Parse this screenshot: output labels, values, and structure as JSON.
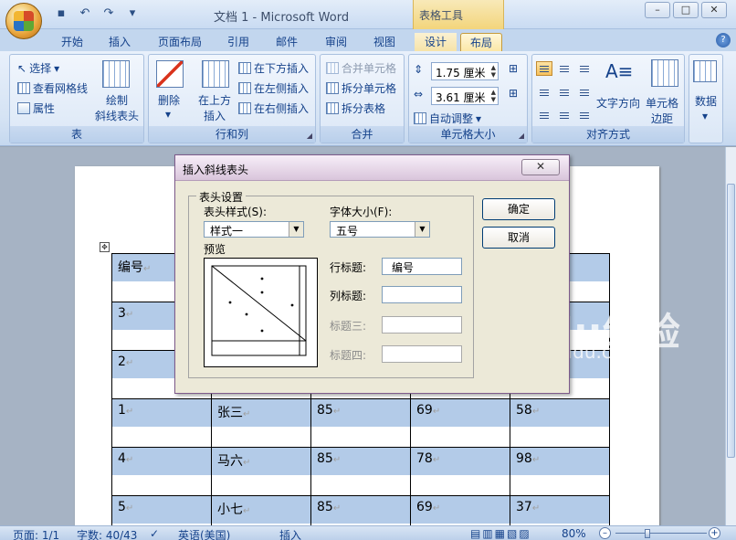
{
  "window": {
    "title": "文档 1 - Microsoft Word",
    "context_tools": "表格工具",
    "buttons": {
      "minimize": "–",
      "maximize": "□",
      "close": "✕"
    }
  },
  "qat": {
    "save_icon": "save-icon",
    "undo_icon": "undo-icon",
    "redo_icon": "redo-icon",
    "customize": "▾"
  },
  "tabs": [
    "开始",
    "插入",
    "页面布局",
    "引用",
    "邮件",
    "审阅",
    "视图",
    "设计",
    "布局"
  ],
  "active_tab": "布局",
  "ribbon": {
    "table_group": {
      "label": "表",
      "select": "选择",
      "view_gridlines": "查看网格线",
      "properties": "属性",
      "draw_diagonal": "绘制\n斜线表头",
      "draw_diagonal_line1": "绘制",
      "draw_diagonal_line2": "斜线表头"
    },
    "rows_cols_group": {
      "label": "行和列",
      "delete": "删除",
      "insert_above_1": "在上方",
      "insert_above_2": "插入",
      "insert_below": "在下方插入",
      "insert_left": "在左侧插入",
      "insert_right": "在右侧插入"
    },
    "merge_group": {
      "label": "合并",
      "merge_cells": "合并单元格",
      "split_cells": "拆分单元格",
      "split_table": "拆分表格"
    },
    "cell_size_group": {
      "label": "单元格大小",
      "height": "1.75 厘米",
      "width": "3.61 厘米",
      "autofit": "自动调整"
    },
    "alignment_group": {
      "label": "对齐方式",
      "text_direction": "文字方向",
      "cell_margins_1": "单元格",
      "cell_margins_2": "边距"
    },
    "data_group": {
      "label": "数据"
    }
  },
  "dialog": {
    "title": "插入斜线表头",
    "close": "✕",
    "section": "表头设置",
    "style_label": "表头样式(S):",
    "style_value": "样式一",
    "font_label": "字体大小(F):",
    "font_value": "五号",
    "preview_label": "预览",
    "row_title_label": "行标题:",
    "row_title_value": "编号",
    "col_title_label": "列标题:",
    "col_title_value": "",
    "title3_label": "标题三:",
    "title4_label": "标题四:",
    "ok": "确定",
    "cancel": "取消"
  },
  "document": {
    "rows": [
      [
        "编号",
        "",
        "",
        "",
        ""
      ],
      [
        "3",
        "",
        "",
        "",
        ""
      ],
      [
        "2",
        "",
        "",
        "",
        ""
      ],
      [
        "1",
        "张三",
        "85",
        "69",
        "58"
      ],
      [
        "4",
        "马六",
        "85",
        "78",
        "98"
      ],
      [
        "5",
        "小七",
        "85",
        "69",
        "37"
      ]
    ],
    "para_mark": "↵"
  },
  "watermark": {
    "brand": "Baidu经验",
    "url": "jingyan.baidu.com"
  },
  "statusbar": {
    "page": "页面: 1/1",
    "words": "字数: 40/43",
    "language": "英语(美国)",
    "mode": "插入",
    "zoom": "80%"
  }
}
